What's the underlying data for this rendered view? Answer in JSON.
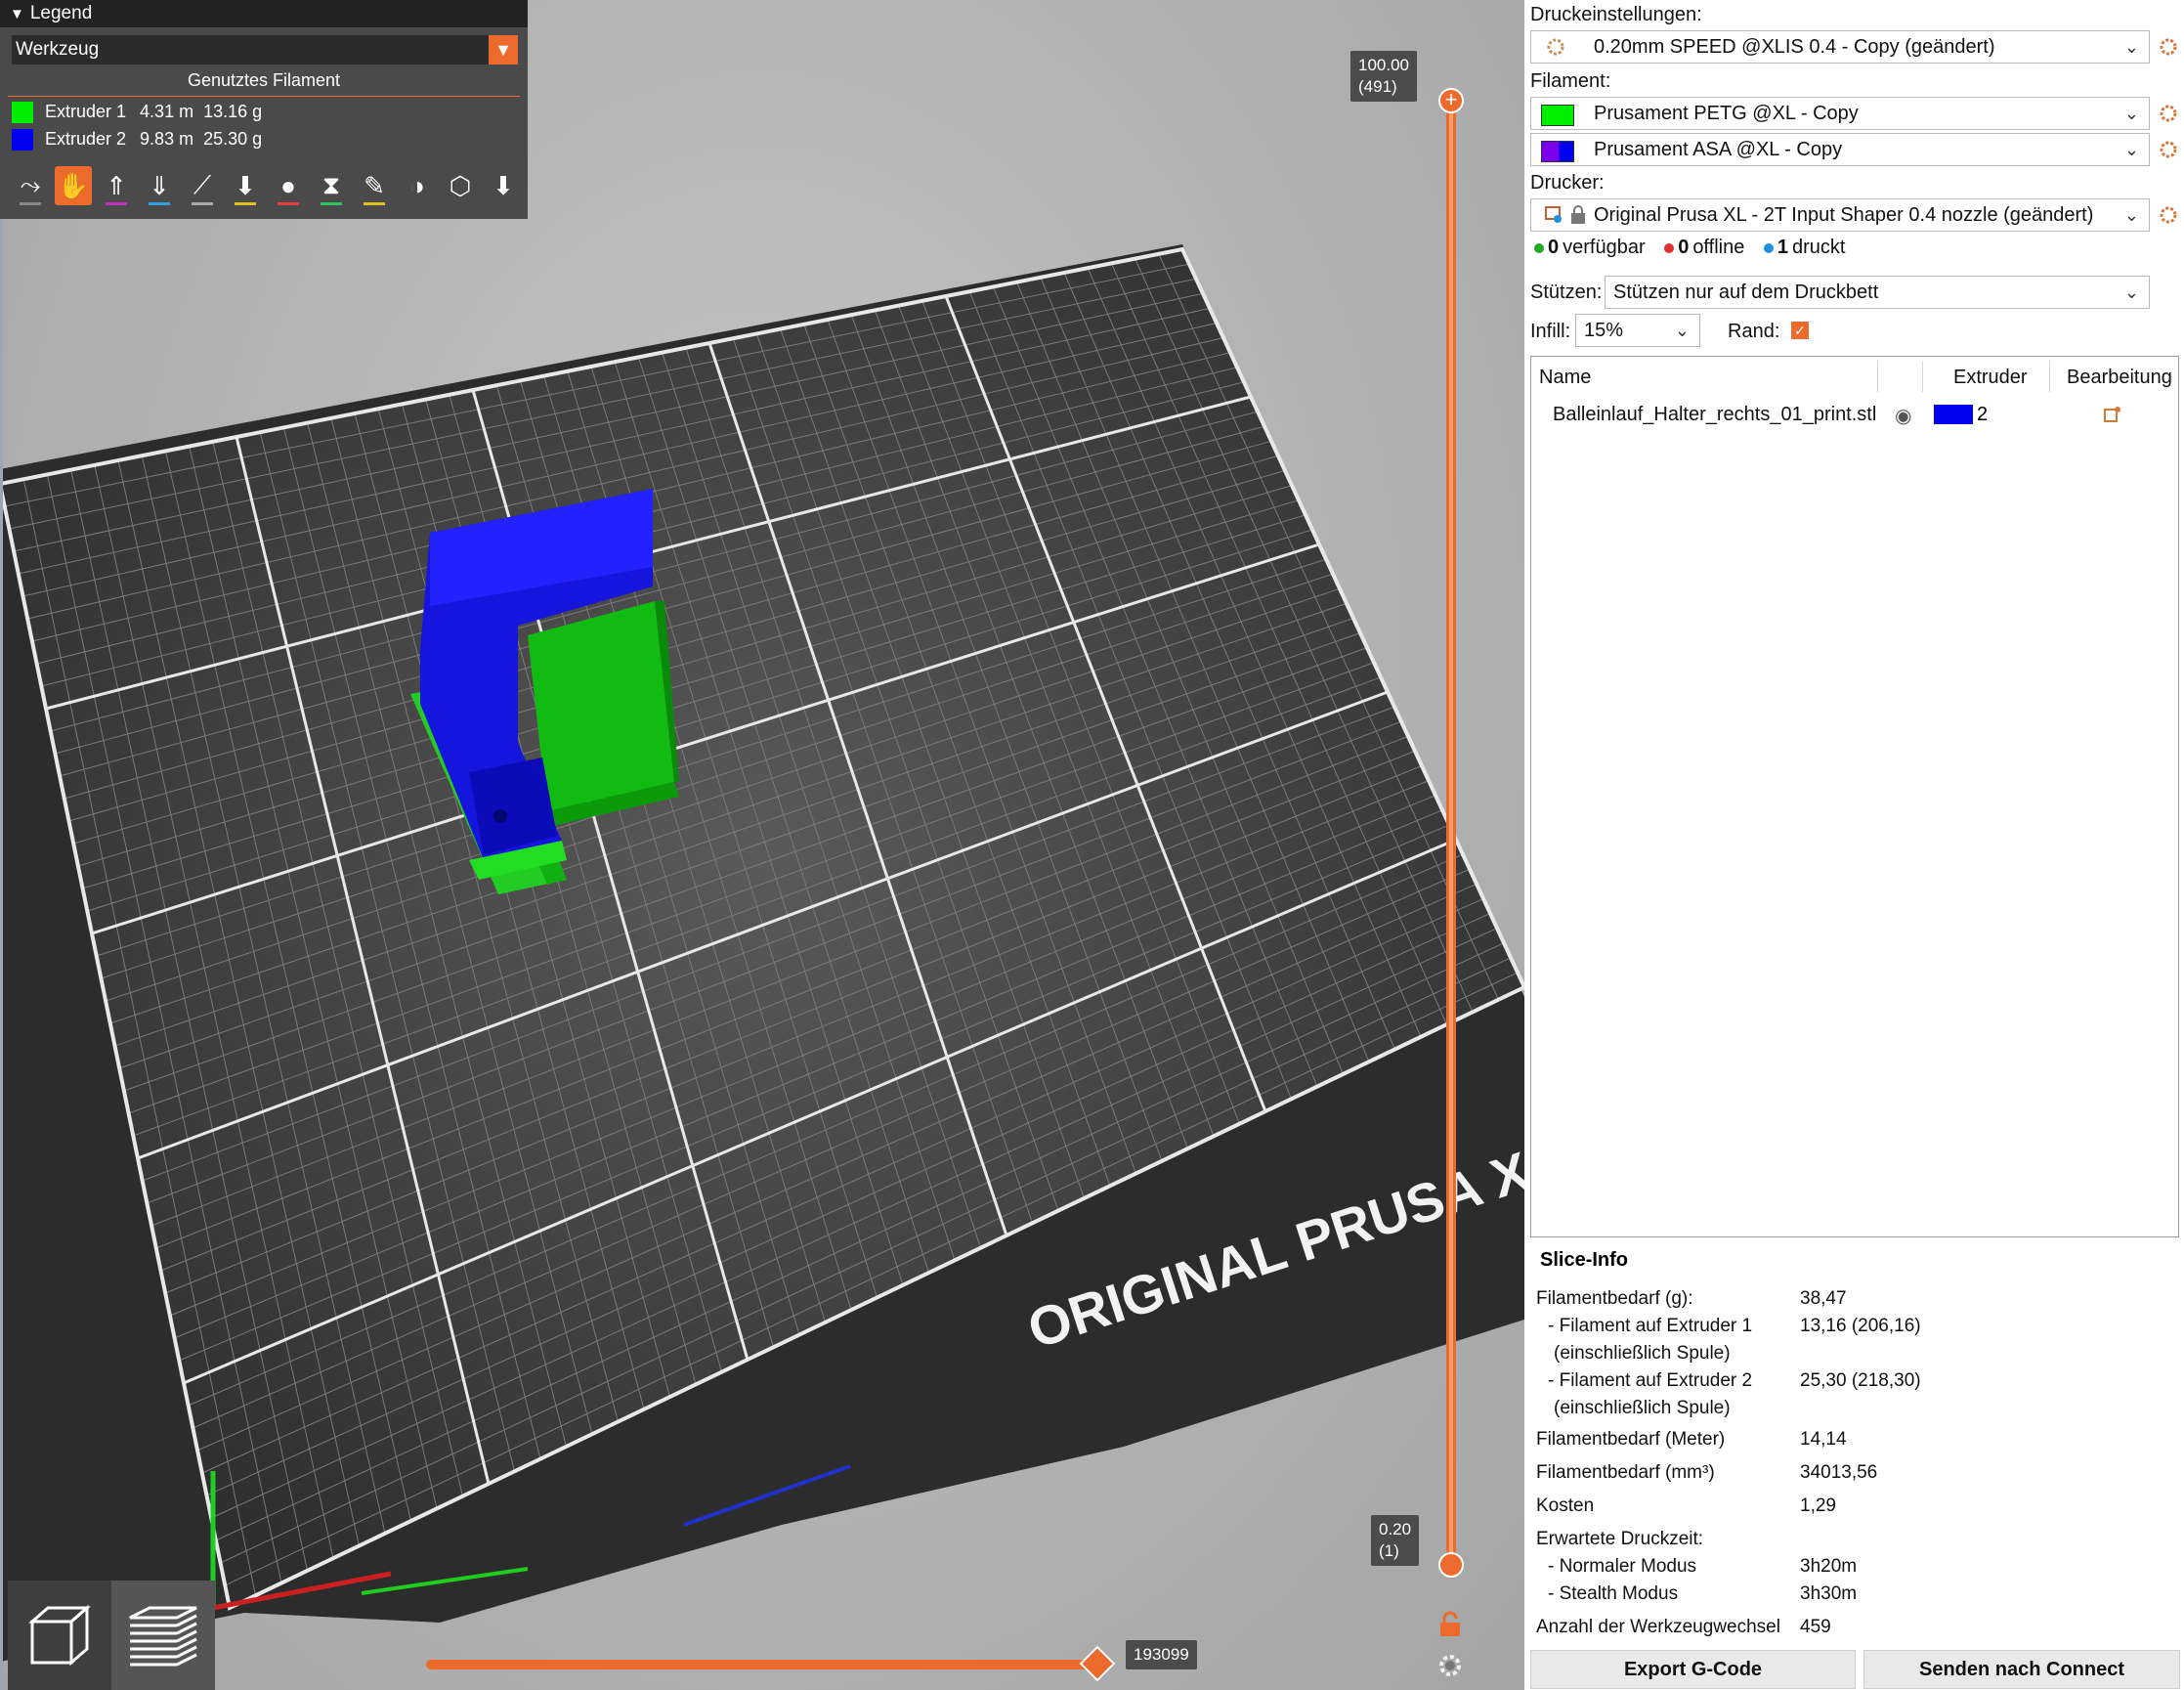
{
  "legend": {
    "title": "Legend",
    "view_type": "Werkzeug",
    "header": "Genutztes Filament",
    "extruders": [
      {
        "label": "Extruder 1",
        "length": "4.31 m",
        "weight": "13.16 g",
        "color": "#00ee00"
      },
      {
        "label": "Extruder 2",
        "length": "9.83 m",
        "weight": "25.30 g",
        "color": "#0000ee"
      }
    ]
  },
  "viewport": {
    "bed_label": "ORIGINAL PRUSA XL",
    "top_height": "100.00",
    "top_layer": "(491)",
    "bottom_height": "0.20",
    "bottom_layer": "(1)",
    "move_count": "193099"
  },
  "panel": {
    "print_settings_label": "Druckeinstellungen:",
    "print_settings": "0.20mm SPEED @XLIS 0.4 - Copy (geändert)",
    "filament_label": "Filament:",
    "filaments": [
      {
        "name": "Prusament PETG @XL - Copy",
        "color": "#00ee00"
      },
      {
        "name": "Prusament ASA @XL - Copy",
        "color": "#7a00ee"
      }
    ],
    "printer_label": "Drucker:",
    "printer": "Original Prusa XL - 2T Input Shaper 0.4 nozzle (geändert)",
    "status": {
      "available_count": "0",
      "available_label": "verfügbar",
      "offline_count": "0",
      "offline_label": "offline",
      "printing_count": "1",
      "printing_label": "druckt"
    },
    "supports_label": "Stützen:",
    "supports_value": "Stützen nur auf dem Druckbett",
    "infill_label": "Infill:",
    "infill_value": "15%",
    "brim_label": "Rand:",
    "object_list": {
      "col_name": "Name",
      "col_extruder": "Extruder",
      "col_edit": "Bearbeitung",
      "objects": [
        {
          "name": "Balleinlauf_Halter_rechts_01_print.stl",
          "extruder": "2"
        }
      ]
    },
    "slice_info": {
      "title": "Slice-Info",
      "rows": [
        {
          "label": "Filamentbedarf (g):",
          "value": "38,47"
        },
        {
          "label": "- Filament auf Extruder 1",
          "value": "13,16 (206,16)"
        },
        {
          "label": "(einschließlich Spule)",
          "value": ""
        },
        {
          "label": "- Filament auf Extruder 2",
          "value": "25,30 (218,30)"
        },
        {
          "label": "(einschließlich Spule)",
          "value": ""
        },
        {
          "label": "Filamentbedarf (Meter)",
          "value": "14,14"
        },
        {
          "label": "Filamentbedarf (mm³)",
          "value": "34013,56"
        },
        {
          "label": "Kosten",
          "value": "1,29"
        },
        {
          "label": "Erwartete Druckzeit:",
          "value": ""
        },
        {
          "label": "- Normaler Modus",
          "value": "3h20m"
        },
        {
          "label": "- Stealth Modus",
          "value": "3h30m"
        },
        {
          "label": "Anzahl der Werkzeugwechsel",
          "value": "459"
        }
      ]
    },
    "export_button": "Export G-Code",
    "send_button": "Senden nach Connect"
  }
}
